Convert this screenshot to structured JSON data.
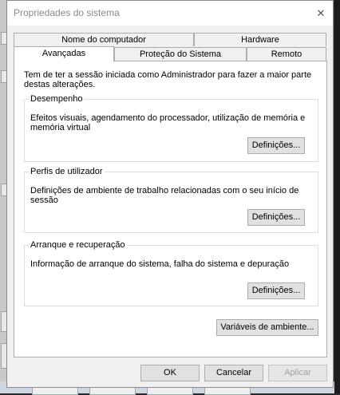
{
  "window": {
    "title": "Propriedades do sistema",
    "close_glyph": "✕"
  },
  "tabs": {
    "row1": [
      {
        "label": "Nome do computador"
      },
      {
        "label": "Hardware"
      }
    ],
    "row2": [
      {
        "label": "Avançadas",
        "active": true
      },
      {
        "label": "Proteção do Sistema"
      },
      {
        "label": "Remoto"
      }
    ]
  },
  "panel": {
    "intro": "Tem de ter a sessão iniciada como Administrador para fazer a maior parte destas alterações.",
    "groups": [
      {
        "title": "Desempenho",
        "description": "Efeitos visuais, agendamento do processador, utilização de memória e memória virtual",
        "button": "Definições..."
      },
      {
        "title": "Perfis de utilizador",
        "description": "Definições de ambiente de trabalho relacionadas com o seu início de sessão",
        "button": "Definições..."
      },
      {
        "title": "Arranque e recuperação",
        "description": "Informação de arranque do sistema, falha do sistema e depuração",
        "button": "Definições..."
      }
    ],
    "env_button": "Variáveis de ambiente..."
  },
  "footer": {
    "ok": "OK",
    "cancel": "Cancelar",
    "apply": "Aplicar"
  }
}
